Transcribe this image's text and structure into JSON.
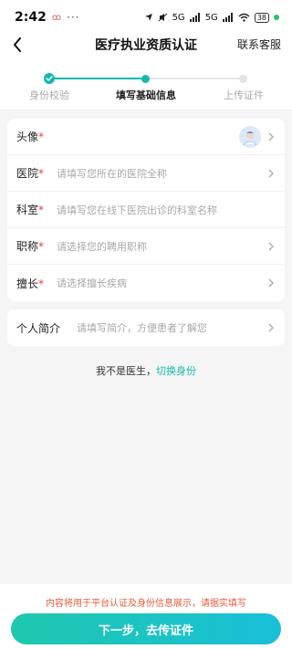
{
  "status_bar": {
    "time": "2:42",
    "left_indicator": "ꝏ",
    "dots": "···",
    "network_1": "5G",
    "network_2": "5G",
    "battery": "38"
  },
  "nav": {
    "title": "医疗执业资质认证",
    "right_action": "联系客服"
  },
  "steps": [
    {
      "label": "身份校验",
      "state": "done"
    },
    {
      "label": "填写基础信息",
      "state": "active"
    },
    {
      "label": "上传证件",
      "state": "todo"
    }
  ],
  "form": {
    "avatar_label": "头像",
    "hospital_label": "医院",
    "hospital_placeholder": "请填写您所在的医院全称",
    "department_label": "科室",
    "department_placeholder": "请填写您在线下医院出诊的科室名称",
    "title_label": "职称",
    "title_placeholder": "请选择您的聘用职称",
    "specialty_label": "擅长",
    "specialty_placeholder": "请选择擅长疾病",
    "required_mark": "*"
  },
  "intro": {
    "label": "个人简介",
    "placeholder": "请填写简介，方便患者了解您"
  },
  "switch": {
    "prefix": "我不是医生，",
    "link": "切换身份"
  },
  "footer": {
    "notice": "内容将用于平台认证及身份信息展示，请据实填写",
    "button": "下一步，去传证件"
  },
  "colors": {
    "accent": "#15b8b0",
    "required": "#e53935",
    "notice": "#e65b3a"
  }
}
